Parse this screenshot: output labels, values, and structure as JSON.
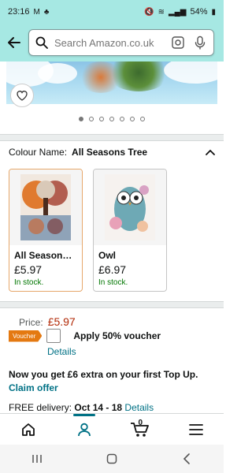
{
  "status": {
    "time": "23:16",
    "battery": "54%"
  },
  "search": {
    "placeholder": "Search Amazon.co.uk"
  },
  "carousel": {
    "dot_count": 7,
    "active_index": 0
  },
  "colour": {
    "label": "Colour Name:",
    "value": "All Seasons Tree"
  },
  "variants": [
    {
      "name": "All Seasons ...",
      "price": "£5.97",
      "stock": "In stock."
    },
    {
      "name": "Owl",
      "price": "£6.97",
      "stock": "In stock."
    }
  ],
  "price": {
    "label": "Price:",
    "value": "£5.97"
  },
  "voucher": {
    "badge": "Voucher",
    "text": "Apply 50% voucher",
    "details": "Details"
  },
  "promo": {
    "topup": "Now you get £6 extra on your first Top Up.",
    "claim": "Claim offer"
  },
  "delivery": {
    "prefix": "FREE delivery:",
    "dates": "Oct 14 - 18",
    "details": "Details"
  },
  "cart": {
    "count": "0"
  },
  "colors": {
    "header_bg": "#a6e8e3",
    "link": "#007185",
    "price": "#b12704",
    "stock": "#007600",
    "voucher_badge": "#e47911"
  }
}
